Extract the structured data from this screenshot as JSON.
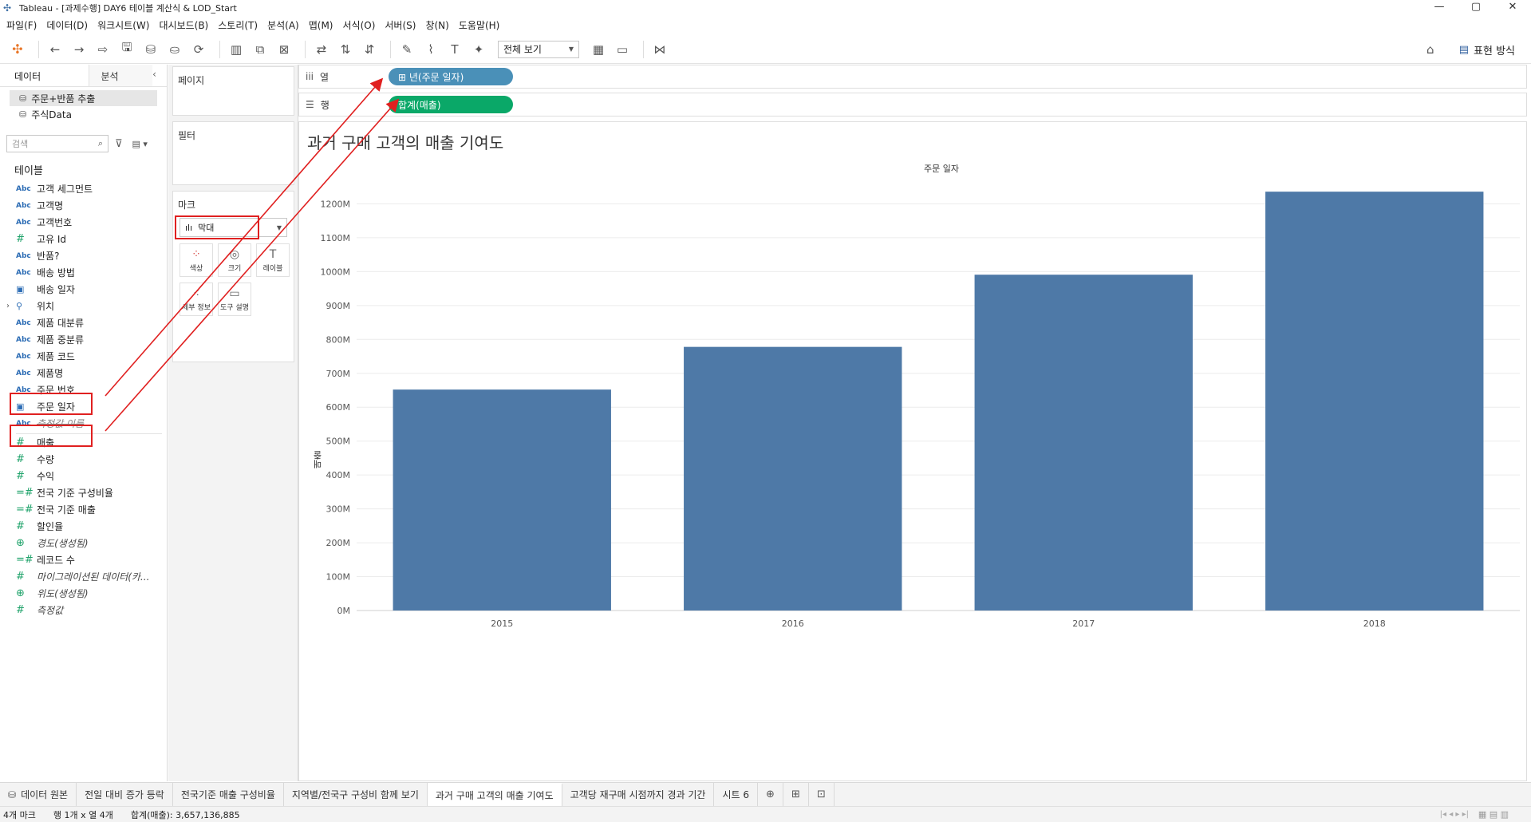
{
  "window": {
    "title": "Tableau - [과제수행] DAY6 테이블 계산식 & LOD_Start",
    "buttons": [
      "—",
      "▢",
      "✕"
    ]
  },
  "menu": [
    "파일(F)",
    "데이터(D)",
    "워크시트(W)",
    "대시보드(B)",
    "스토리(T)",
    "분석(A)",
    "맵(M)",
    "서식(O)",
    "서버(S)",
    "창(N)",
    "도움말(H)"
  ],
  "toolbar": {
    "view_select": "전체 보기",
    "show_me_label": "표현 방식"
  },
  "datapane": {
    "tab_data": "데이터",
    "tab_analysis": "분석",
    "sources": [
      "주문+반품 추출",
      "주식Data"
    ],
    "search_placeholder": "검색",
    "section_title": "테이블",
    "fields": [
      {
        "icon": "Abc",
        "label": "고객 세그먼트"
      },
      {
        "icon": "Abc",
        "label": "고객명"
      },
      {
        "icon": "Abc",
        "label": "고객번호"
      },
      {
        "icon": "#",
        "label": "고유 Id"
      },
      {
        "icon": "Abc",
        "label": "반품?"
      },
      {
        "icon": "Abc",
        "label": "배송 방법"
      },
      {
        "icon": "date",
        "label": "배송 일자"
      },
      {
        "icon": "geo",
        "label": "위치"
      },
      {
        "icon": "Abc",
        "label": "제품 대분류"
      },
      {
        "icon": "Abc",
        "label": "제품 중분류"
      },
      {
        "icon": "Abc",
        "label": "제품 코드"
      },
      {
        "icon": "Abc",
        "label": "제품명"
      },
      {
        "icon": "Abc",
        "label": "주문 번호"
      },
      {
        "icon": "date",
        "label": "주문 일자"
      },
      {
        "icon": "Abc",
        "label": "측정값 이름"
      }
    ],
    "measures": [
      {
        "icon": "#",
        "label": "매출"
      },
      {
        "icon": "#",
        "label": "수량"
      },
      {
        "icon": "#",
        "label": "수익"
      },
      {
        "icon": "=#",
        "label": "전국 기준 구성비율"
      },
      {
        "icon": "=#",
        "label": "전국 기준 매출"
      },
      {
        "icon": "#",
        "label": "할인율"
      },
      {
        "icon": "globe",
        "label": "경도(생성됨)"
      },
      {
        "icon": "=#",
        "label": "레코드 수"
      },
      {
        "icon": "#",
        "label": "마이그레이션된 데이터(카..."
      },
      {
        "icon": "globe",
        "label": "위도(생성됨)"
      },
      {
        "icon": "#",
        "label": "측정값"
      }
    ]
  },
  "cards": {
    "pages": "페이지",
    "filters": "필터",
    "marks": "마크",
    "mark_type": "막대",
    "mark_buttons": [
      "색상",
      "크기",
      "레이블",
      "세부 정보",
      "도구 설명"
    ]
  },
  "shelves": {
    "columns_label": "열",
    "rows_label": "행",
    "columns_pill": "⊞ 년(주문 일자)",
    "rows_pill": "합계(매출)"
  },
  "view": {
    "title": "과거 구매 고객의 매출 기여도",
    "column_header": "주문 일자",
    "y_axis_title": "매출"
  },
  "chart_data": {
    "type": "bar",
    "title": "과거 구매 고객의 매출 기여도",
    "xlabel": "주문 일자",
    "ylabel": "매출",
    "categories": [
      "2015",
      "2016",
      "2017",
      "2018"
    ],
    "values": [
      652,
      778,
      991,
      1236
    ],
    "unit": "M",
    "ylim": [
      0,
      1300
    ],
    "y_ticks": [
      0,
      100,
      200,
      300,
      400,
      500,
      600,
      700,
      800,
      900,
      1000,
      1100,
      1200
    ],
    "y_tick_labels": [
      "0M",
      "100M",
      "200M",
      "300M",
      "400M",
      "500M",
      "600M",
      "700M",
      "800M",
      "900M",
      "1000M",
      "1100M",
      "1200M"
    ],
    "bar_color": "#4e79a7",
    "grid": true
  },
  "sheet_tabs": {
    "source_tab": "데이터 원본",
    "tabs": [
      "전일 대비 증가 등락",
      "전국기준 매출 구성비율",
      "지역별/전국구 구성비 함께 보기",
      "과거 구매 고객의 매출 기여도",
      "고객당 재구매 시점까지 경과 기간",
      "시트 6"
    ],
    "active_index": 3
  },
  "status": {
    "marks": "4개 마크",
    "rows_cols": "행 1개 x 열 4개",
    "sum": "합계(매출): 3,657,136,885"
  },
  "colors": {
    "annotation_red": "#e02020",
    "dimension_pill": "#4a90b8",
    "measure_pill": "#0aa868"
  }
}
